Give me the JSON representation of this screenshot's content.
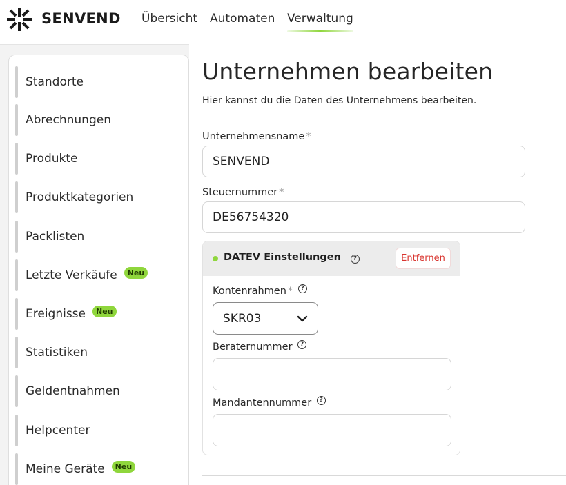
{
  "brand": {
    "name": "SENVEND",
    "accent": "#8fd63c",
    "logo_icon": "starburst-logo"
  },
  "nav": {
    "items": [
      {
        "label": "Übersicht",
        "active": false
      },
      {
        "label": "Automaten",
        "active": false
      },
      {
        "label": "Verwaltung",
        "active": true
      }
    ]
  },
  "sidebar": {
    "items": [
      {
        "label": "Standorte",
        "badge": ""
      },
      {
        "label": "Abrechnungen",
        "badge": ""
      },
      {
        "label": "Produkte",
        "badge": ""
      },
      {
        "label": "Produktkategorien",
        "badge": ""
      },
      {
        "label": "Packlisten",
        "badge": ""
      },
      {
        "label": "Letzte Verkäufe",
        "badge": "Neu"
      },
      {
        "label": "Ereignisse",
        "badge": "Neu"
      },
      {
        "label": "Statistiken",
        "badge": ""
      },
      {
        "label": "Geldentnahmen",
        "badge": ""
      },
      {
        "label": "Helpcenter",
        "badge": ""
      },
      {
        "label": "Meine Geräte",
        "badge": "Neu"
      }
    ]
  },
  "page": {
    "title": "Unternehmen bearbeiten",
    "subtitle": "Hier kannst du die Daten des Unternehmens bearbeiten."
  },
  "form": {
    "company_name": {
      "label": "Unternehmensname",
      "required_mark": "*",
      "value": "SENVEND"
    },
    "tax_number": {
      "label": "Steuernummer",
      "required_mark": "*",
      "value": "DE56754320"
    }
  },
  "datev": {
    "title": "DATEV Einstellungen",
    "help_icon": "question-circle-icon",
    "remove_label": "Entfernen",
    "chart_of_accounts": {
      "label": "Kontenrahmen",
      "required_mark": "*",
      "selected": "SKR03"
    },
    "advisor_number": {
      "label": "Beraternummer",
      "value": ""
    },
    "client_number": {
      "label": "Mandantennummer",
      "value": ""
    }
  }
}
